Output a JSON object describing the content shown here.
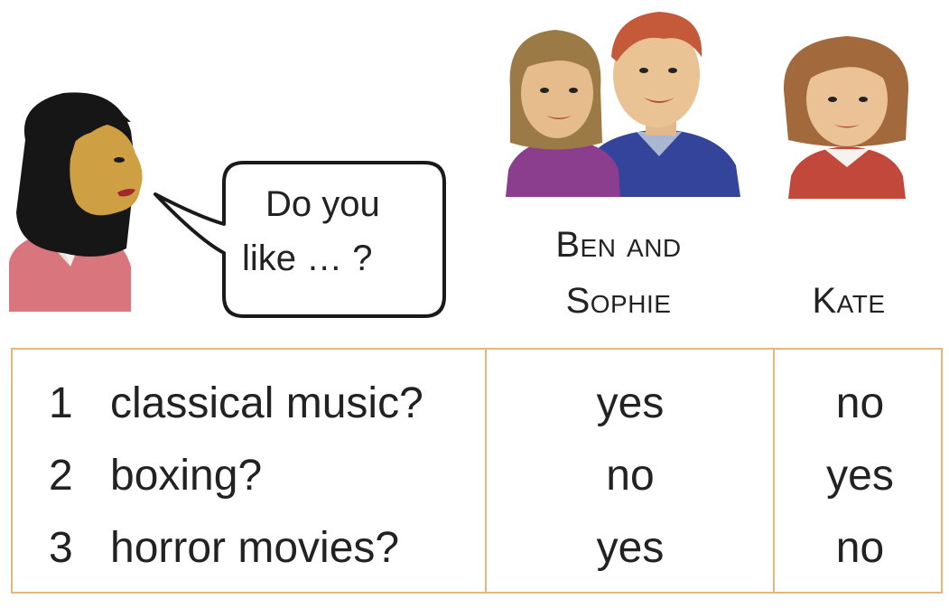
{
  "speech_bubble": {
    "line1": "Do you",
    "line2": "like … ?"
  },
  "people": {
    "group1_line1": "Ben and",
    "group1_line2": "Sophie",
    "group2": "Kate"
  },
  "table": {
    "rows": [
      {
        "number": "1",
        "question": "classical music?",
        "ben_and_sophie": "yes",
        "kate": "no"
      },
      {
        "number": "2",
        "question": "boxing?",
        "ben_and_sophie": "no",
        "kate": "yes"
      },
      {
        "number": "3",
        "question": "horror movies?",
        "ben_and_sophie": "yes",
        "kate": "no"
      }
    ]
  },
  "colors": {
    "table_border": "#e3b77a",
    "woman_top": "#d9757c",
    "sophie_top": "#8a3e8d",
    "ben_top": "#33449a",
    "kate_top": "#c2483b"
  }
}
